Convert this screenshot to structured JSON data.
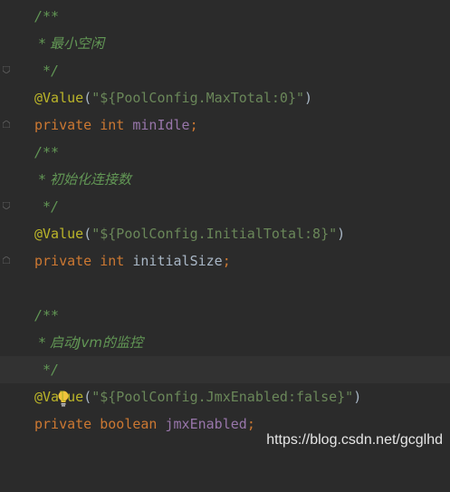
{
  "code_lines": {
    "l1": {
      "doc": "/**"
    },
    "l2": {
      "doc": " * 最小空闲"
    },
    "l3": {
      "doc": " */"
    },
    "l4": {
      "ann": "@Value",
      "open": "(",
      "str": "\"${PoolConfig.MaxTotal:0}\"",
      "close": ")"
    },
    "l5": {
      "kw1": "private",
      "kw2": "int",
      "field": "minIdle",
      "semi": ";"
    },
    "l6": {
      "doc": "/**"
    },
    "l7": {
      "doc": " * 初始化连接数"
    },
    "l8": {
      "doc": " */"
    },
    "l9": {
      "ann": "@Value",
      "open": "(",
      "str": "\"${PoolConfig.InitialTotal:8}\"",
      "close": ")"
    },
    "l10": {
      "kw1": "private",
      "kw2": "int",
      "field": "initialSize",
      "semi": ";"
    },
    "l12": {
      "doc": "/**"
    },
    "l13": {
      "doc": " * 启动Jvm的监控"
    },
    "l14": {
      "doc": " */"
    },
    "l15": {
      "ann": "@Value",
      "open": "(",
      "str": "\"${PoolConfig.JmxEnabled:false}\"",
      "close": ")"
    },
    "l16": {
      "kw1": "private",
      "kw2": "boolean",
      "field": "jmxEnabled",
      "semi": ";"
    }
  },
  "watermark": "https://blog.csdn.net/gcglhd",
  "colors": {
    "background": "#2b2b2b",
    "doc_comment": "#629755",
    "annotation": "#bbb529",
    "string": "#6a8759",
    "keyword": "#cc7832",
    "field": "#9876aa"
  },
  "icons": [
    "fold-marker-icon",
    "lightbulb-icon"
  ]
}
